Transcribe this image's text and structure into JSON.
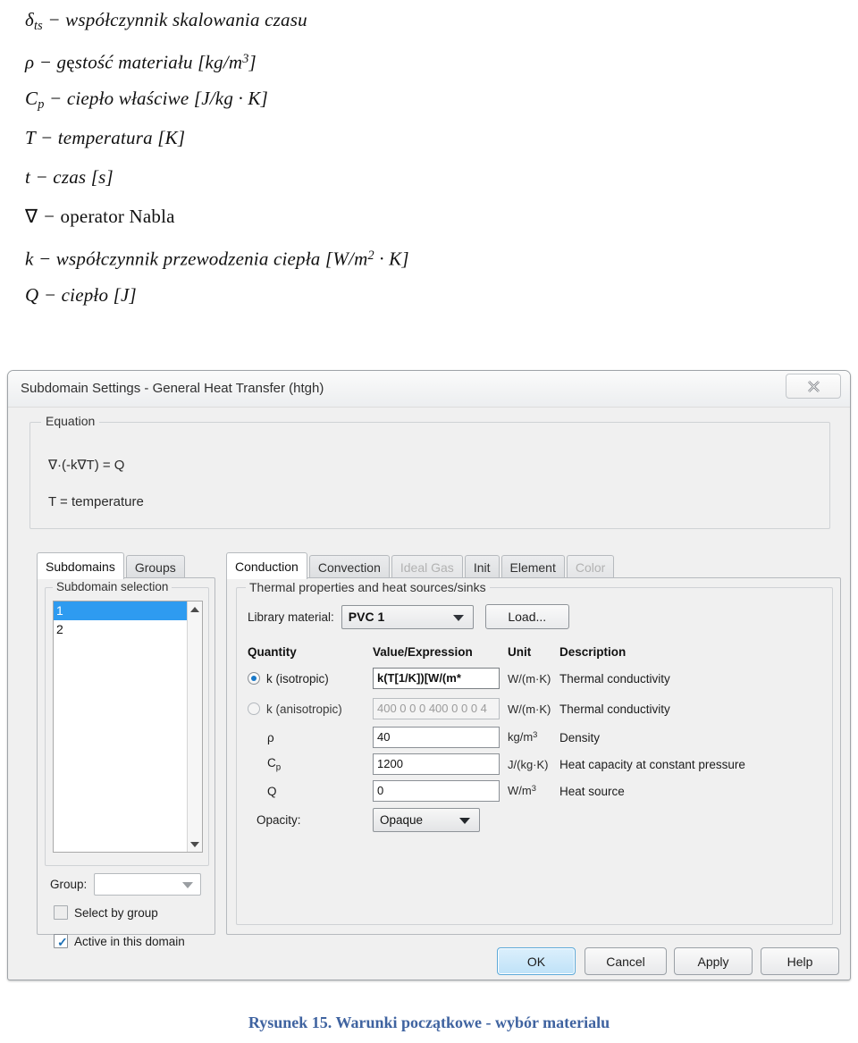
{
  "nomenclature": [
    {
      "id": "delta-ts",
      "html_symbol": "δ<sub>ts</sub>",
      "text": "δts — współczynnik skalowania czasu"
    },
    {
      "id": "rho",
      "text": "ρ — gęstość materiału [kg/m3]"
    },
    {
      "id": "cp",
      "text": "Cp — ciepło właściwe [J/kg · K]"
    },
    {
      "id": "temperature",
      "text": "T — temperatura [K]"
    },
    {
      "id": "time",
      "text": "t — czas [s]"
    },
    {
      "id": "nabla",
      "text": "∇ — operator Nabla"
    },
    {
      "id": "k-conductivity",
      "text": "k — współczynnik przewodzenia ciepła [W/m2 · K]"
    },
    {
      "id": "heat",
      "text": "Q — ciepło [J]"
    }
  ],
  "dialog": {
    "title": "Subdomain Settings - General Heat Transfer (htgh)",
    "close_icon": "close-icon",
    "equation": {
      "legend": "Equation",
      "line1": "∇·(-k∇T) = Q",
      "line2": "T = temperature"
    },
    "left_tabs": [
      {
        "label": "Subdomains",
        "active": true,
        "disabled": false
      },
      {
        "label": "Groups",
        "active": false,
        "disabled": false
      }
    ],
    "subdomain_panel": {
      "legend": "Subdomain selection",
      "items": [
        "1",
        "2"
      ],
      "selected_index": 0,
      "group_label": "Group:",
      "group_value": "",
      "checkboxes": [
        {
          "label": "Select by group",
          "checked": false
        },
        {
          "label": "Active in this domain",
          "checked": true
        }
      ]
    },
    "right_tabs": [
      {
        "label": "Conduction",
        "active": true,
        "disabled": false
      },
      {
        "label": "Convection",
        "active": false,
        "disabled": false
      },
      {
        "label": "Ideal Gas",
        "active": false,
        "disabled": true
      },
      {
        "label": "Init",
        "active": false,
        "disabled": false
      },
      {
        "label": "Element",
        "active": false,
        "disabled": false
      },
      {
        "label": "Color",
        "active": false,
        "disabled": true
      }
    ],
    "conduction_panel": {
      "legend": "Thermal properties and heat sources/sinks",
      "library_material_label": "Library material:",
      "library_material_value": "PVC 1",
      "load_button": "Load...",
      "table_headers": {
        "quantity": "Quantity",
        "value": "Value/Expression",
        "unit": "Unit",
        "description": "Description"
      },
      "rows": [
        {
          "quantity": "k (isotropic)",
          "control": "radio",
          "selected": true,
          "value": "k(T[1/K])[W/(m*",
          "value_enabled": true,
          "unit": "W/(m·K)",
          "unit_sup": "",
          "description": "Thermal conductivity"
        },
        {
          "quantity": "k (anisotropic)",
          "control": "radio",
          "selected": false,
          "value": "400 0 0 0 400 0 0 0 4",
          "value_enabled": false,
          "unit": "W/(m·K)",
          "unit_sup": "",
          "description": "Thermal conductivity"
        },
        {
          "quantity": "ρ",
          "control": "none",
          "selected": false,
          "value": "40",
          "value_enabled": true,
          "unit": "kg/m",
          "unit_sup": "3",
          "description": "Density"
        },
        {
          "quantity": "Cp",
          "control": "none",
          "selected": false,
          "value": "1200",
          "value_enabled": true,
          "unit": "J/(kg·K)",
          "unit_sup": "",
          "description": "Heat capacity at constant pressure"
        },
        {
          "quantity": "Q",
          "control": "none",
          "selected": false,
          "value": "0",
          "value_enabled": true,
          "unit": "W/m",
          "unit_sup": "3",
          "description": "Heat source"
        }
      ],
      "opacity_label": "Opacity:",
      "opacity_value": "Opaque"
    },
    "footer_buttons": [
      {
        "label": "OK",
        "primary": true
      },
      {
        "label": "Cancel",
        "primary": false
      },
      {
        "label": "Apply",
        "primary": false
      },
      {
        "label": "Help",
        "primary": false
      }
    ]
  },
  "caption": "Rysunek 15. Warunki początkowe - wybór materialu",
  "colors": {
    "selection_blue": "#2e9bf0",
    "caption_blue": "#3f63a0",
    "radio_dot": "#1878c8",
    "primary_button": "#bfe2f8"
  }
}
